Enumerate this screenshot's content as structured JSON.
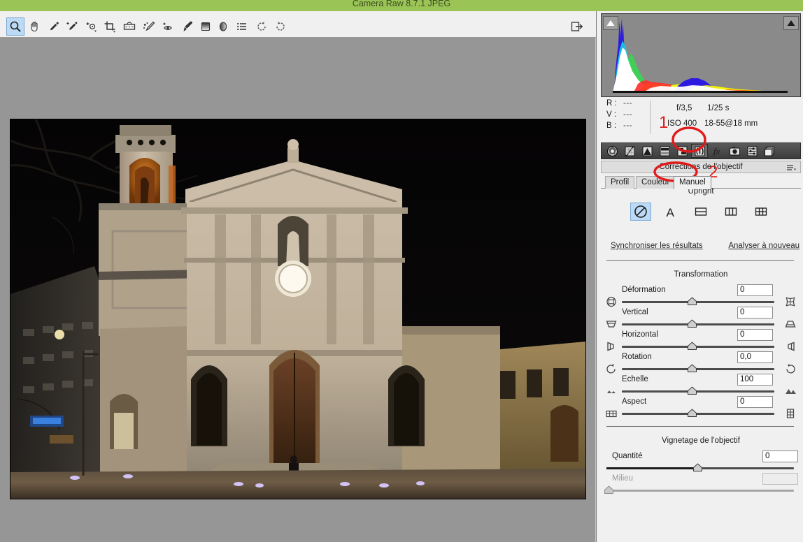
{
  "window": {
    "title": "Camera Raw 8.7.1    JPEG",
    "titlebar_color": "#9ac556"
  },
  "toolbar": {
    "tools": [
      {
        "name": "zoom-tool",
        "label": "Zoom",
        "selected": true
      },
      {
        "name": "hand-tool",
        "label": "Main",
        "selected": false
      },
      {
        "name": "white-balance-tool",
        "label": "Balance des blancs",
        "selected": false
      },
      {
        "name": "color-sampler-tool",
        "label": "Échantillonnage de couleur",
        "selected": false
      },
      {
        "name": "targeted-adjustment-tool",
        "label": "Réglage ciblé",
        "selected": false
      },
      {
        "name": "crop-tool",
        "label": "Recadrage",
        "selected": false
      },
      {
        "name": "straighten-tool",
        "label": "Redressement",
        "selected": false
      },
      {
        "name": "spot-removal-tool",
        "label": "Retouche des tons directs",
        "selected": false
      },
      {
        "name": "red-eye-tool",
        "label": "Suppression des yeux rouges",
        "selected": false
      },
      {
        "name": "adjustment-brush-tool",
        "label": "Pinceau de retouche",
        "selected": false
      },
      {
        "name": "graduated-filter-tool",
        "label": "Filtre gradué",
        "selected": false
      },
      {
        "name": "radial-filter-tool",
        "label": "Filtre radial",
        "selected": false
      },
      {
        "name": "preferences-tool",
        "label": "Préférences",
        "selected": false
      },
      {
        "name": "rotate-left-tool",
        "label": "Rotation à gauche",
        "selected": false
      },
      {
        "name": "rotate-right-tool",
        "label": "Rotation à droite",
        "selected": false
      }
    ],
    "open_preferences_label": "Ouvrir la boîte de dialogue Préférences"
  },
  "histogram": {
    "shadow_clipping_label": "Écrêtage des tons foncés",
    "highlight_clipping_label": "Écrêtage des tons clairs"
  },
  "info": {
    "r_label": "R :",
    "v_label": "V :",
    "b_label": "B :",
    "r_value": "---",
    "v_value": "---",
    "b_value": "---",
    "aperture": "f/3,5",
    "shutter": "1/25 s",
    "iso": "ISO 400",
    "lens": "18-55@18 mm"
  },
  "panel_tabs": [
    {
      "name": "basic-tab",
      "label": "Réglages de base",
      "icon": "aperture-icon",
      "selected": false
    },
    {
      "name": "tone-curve-tab",
      "label": "Courbe des tonalités",
      "icon": "curve-icon",
      "selected": false
    },
    {
      "name": "detail-tab",
      "label": "Détail",
      "icon": "triangle-icon",
      "selected": false
    },
    {
      "name": "hsl-tab",
      "label": "TSL / Niveaux de gris",
      "icon": "hsl-icon",
      "selected": false
    },
    {
      "name": "split-toning-tab",
      "label": "Virage partiel",
      "icon": "split-tone-icon",
      "selected": false
    },
    {
      "name": "lens-corrections-tab",
      "label": "Corrections de l'objectif",
      "icon": "lens-icon",
      "selected": true
    },
    {
      "name": "effects-tab",
      "label": "Effets",
      "icon": "fx-icon",
      "selected": false
    },
    {
      "name": "camera-calibration-tab",
      "label": "Étalonnage de l'appareil photo",
      "icon": "camera-icon",
      "selected": false
    },
    {
      "name": "presets-tab",
      "label": "Paramètres prédéfinis",
      "icon": "presets-icon",
      "selected": false
    },
    {
      "name": "snapshots-tab",
      "label": "Instantanés",
      "icon": "snapshots-icon",
      "selected": false
    }
  ],
  "panel": {
    "header_title": "Corrections de l'objectif",
    "menu_icon": "panel-menu-icon",
    "tabs": [
      {
        "name": "tab-profil",
        "label": "Profil",
        "selected": false
      },
      {
        "name": "tab-couleur",
        "label": "Couleur",
        "selected": false
      },
      {
        "name": "tab-manuel",
        "label": "Manuel",
        "selected": true
      }
    ]
  },
  "upright": {
    "title": "Upright",
    "buttons": [
      {
        "name": "upright-off-button",
        "label": "Désactivé",
        "icon": "no-entry-icon",
        "selected": true
      },
      {
        "name": "upright-auto-button",
        "label": "Auto",
        "icon": "letter-a-icon",
        "selected": false
      },
      {
        "name": "upright-level-button",
        "label": "Niveau",
        "icon": "horizontal-lines-icon",
        "selected": false
      },
      {
        "name": "upright-vertical-button",
        "label": "Vertical",
        "icon": "vertical-lines-icon",
        "selected": false
      },
      {
        "name": "upright-full-button",
        "label": "Plein",
        "icon": "grid-icon",
        "selected": false
      }
    ],
    "sync_link": "Synchroniser les résultats",
    "reanalyze_link": "Analyser à nouveau"
  },
  "transformation": {
    "title": "Transformation",
    "sliders": [
      {
        "name": "slider-deformation",
        "label": "Déformation",
        "value": "0",
        "knob_pct": 50,
        "icon_left": "barrel-distortion-icon",
        "icon_right": "pincushion-distortion-icon",
        "disabled": false
      },
      {
        "name": "slider-vertical",
        "label": "Vertical",
        "value": "0",
        "knob_pct": 50,
        "icon_left": "keystone-down-icon",
        "icon_right": "keystone-up-icon",
        "disabled": false
      },
      {
        "name": "slider-horizontal",
        "label": "Horizontal",
        "value": "0",
        "knob_pct": 50,
        "icon_left": "keystone-left-icon",
        "icon_right": "keystone-right-icon",
        "disabled": false
      },
      {
        "name": "slider-rotation",
        "label": "Rotation",
        "value": "0,0",
        "knob_pct": 50,
        "icon_left": "rotate-ccw-icon",
        "icon_right": "rotate-cw-icon",
        "disabled": false
      },
      {
        "name": "slider-echelle",
        "label": "Echelle",
        "value": "100",
        "knob_pct": 50,
        "icon_left": "scale-small-icon",
        "icon_right": "scale-large-icon",
        "disabled": false
      },
      {
        "name": "slider-aspect",
        "label": "Aspect",
        "value": "0",
        "knob_pct": 50,
        "icon_left": "aspect-wide-icon",
        "icon_right": "aspect-tall-icon",
        "disabled": false
      }
    ]
  },
  "vignetting": {
    "title": "Vignetage de l'objectif",
    "sliders": [
      {
        "name": "slider-quantite",
        "label": "Quantité",
        "value": "0",
        "knob_pct": 50,
        "disabled": false
      },
      {
        "name": "slider-milieu",
        "label": "Milieu",
        "value": "",
        "knob_pct": 2,
        "disabled": true
      }
    ]
  },
  "annotations": [
    {
      "name": "annotation-number-1",
      "text": "1"
    },
    {
      "name": "annotation-number-2",
      "text": "2"
    }
  ],
  "photo": {
    "alt_name": "night-church-photo",
    "description": "Église de nuit éclairée, place avec passante"
  },
  "colors": {
    "title_bar": "#9ac556",
    "canvas": "#969696",
    "panel_bg": "#f0f0f0",
    "annotation_red": "#e11b1b",
    "selection_blue": "#bcd9f5"
  }
}
